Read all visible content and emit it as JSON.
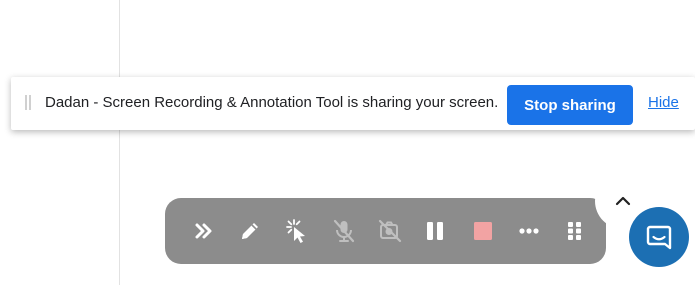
{
  "share_bar": {
    "message": "Dadan - Screen Recording & Annotation Tool is sharing your screen.",
    "stop_label": "Stop sharing",
    "hide_label": "Hide"
  },
  "toolbar": {
    "buttons": [
      {
        "name": "collapse-toolbar",
        "icon": "double-chevron-right-icon"
      },
      {
        "name": "pen-tool",
        "icon": "pencil-icon"
      },
      {
        "name": "click-effect",
        "icon": "cursor-click-icon"
      },
      {
        "name": "microphone-muted",
        "icon": "mic-off-icon"
      },
      {
        "name": "camera-off",
        "icon": "camera-off-icon"
      },
      {
        "name": "pause-recording",
        "icon": "pause-icon"
      },
      {
        "name": "stop-recording",
        "icon": "stop-square-icon"
      },
      {
        "name": "more-options",
        "icon": "more-horizontal-icon"
      },
      {
        "name": "apps-menu",
        "icon": "grid-icon"
      }
    ]
  },
  "scroll_top": {
    "icon": "chevron-up-icon"
  },
  "chat": {
    "icon": "chat-bubble-icon"
  },
  "colors": {
    "accent": "#1a73e8",
    "toolbar_bg": "#8c8c8c",
    "stop_square": "#f2a3a3",
    "chat_bg": "#1c6fb3"
  }
}
